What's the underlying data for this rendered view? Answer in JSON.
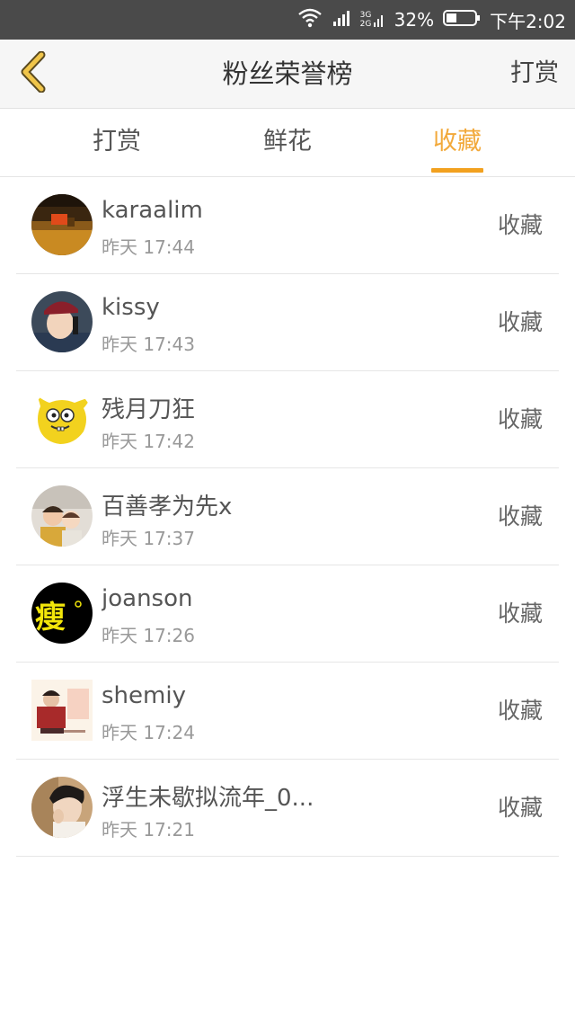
{
  "status_bar": {
    "network": "3G 2G",
    "battery": "32%",
    "time": "下午2:02"
  },
  "header": {
    "title": "粉丝荣誉榜",
    "action": "打赏",
    "back_icon": "chevron-left-icon",
    "accent_color": "#f2a93b"
  },
  "tabs": [
    {
      "label": "打赏",
      "active": false
    },
    {
      "label": "鲜花",
      "active": false
    },
    {
      "label": "收藏",
      "active": true
    }
  ],
  "list": [
    {
      "name": "karaalim",
      "time": "昨天 17:44",
      "type": "收藏",
      "avatar": "avatar-image"
    },
    {
      "name": "kissy",
      "time": "昨天 17:43",
      "type": "收藏",
      "avatar": "avatar-image"
    },
    {
      "name": "残月刀狂",
      "time": "昨天 17:42",
      "type": "收藏",
      "avatar": "avatar-image"
    },
    {
      "name": "百善孝为先x",
      "time": "昨天 17:37",
      "type": "收藏",
      "avatar": "avatar-image"
    },
    {
      "name": "joanson",
      "time": "昨天 17:26",
      "type": "收藏",
      "avatar": "avatar-image",
      "avatar_text": "瘦"
    },
    {
      "name": "shemiy",
      "time": "昨天 17:24",
      "type": "收藏",
      "avatar": "avatar-image"
    },
    {
      "name": "浮生未歇拟流年_0...",
      "time": "昨天 17:21",
      "type": "收藏",
      "avatar": "avatar-image"
    }
  ]
}
